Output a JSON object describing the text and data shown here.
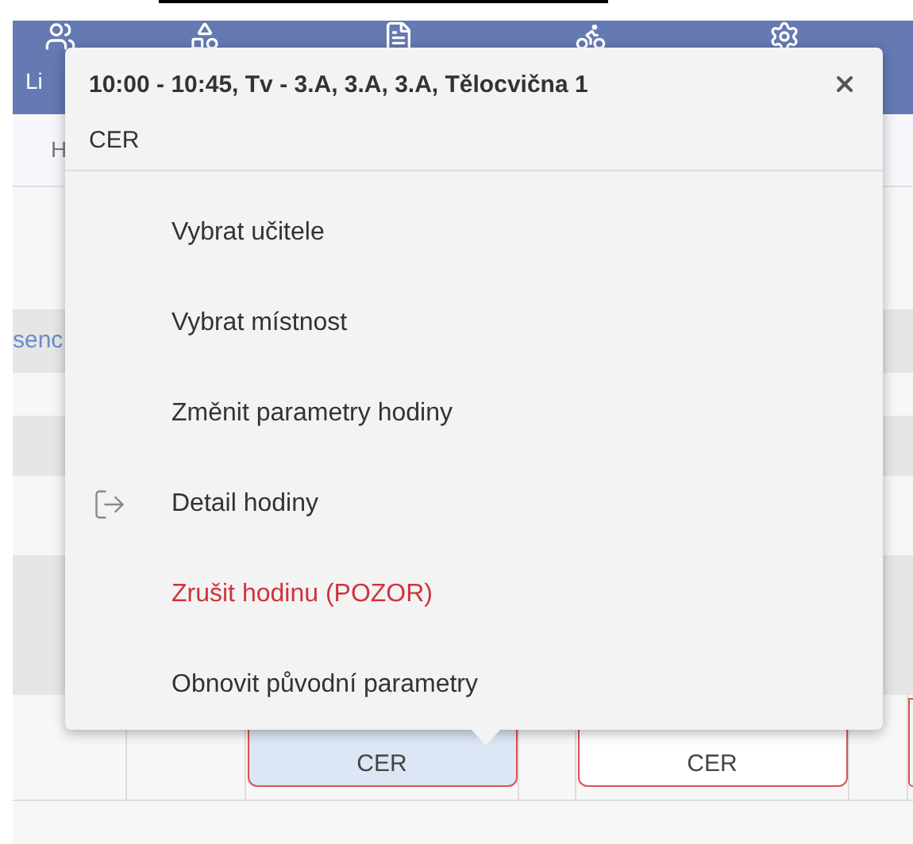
{
  "header": {
    "nav_label": "Li",
    "sub_label": "H",
    "side_link": "senc"
  },
  "popup": {
    "title": "10:00 - 10:45, Tv - 3.A, 3.A, 3.A, Tělocvična 1",
    "subtitle": "CER",
    "items": [
      {
        "label": "Vybrat učitele",
        "kind": "plain"
      },
      {
        "label": "Vybrat místnost",
        "kind": "plain"
      },
      {
        "label": "Změnit parametry hodiny",
        "kind": "plain"
      },
      {
        "label": "Detail hodiny",
        "kind": "icon"
      },
      {
        "label": "Zrušit hodinu (POZOR)",
        "kind": "danger"
      },
      {
        "label": "Obnovit původní parametry",
        "kind": "plain"
      }
    ]
  },
  "lessons": [
    {
      "label": "CER",
      "selected": true
    },
    {
      "label": "CER",
      "selected": false
    }
  ]
}
